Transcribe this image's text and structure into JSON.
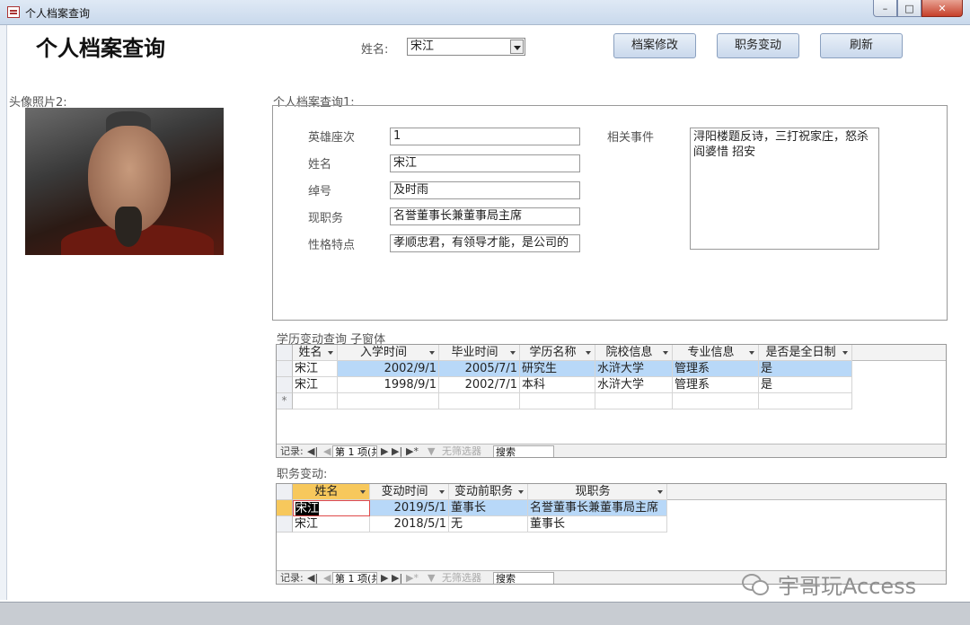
{
  "window": {
    "title": "个人档案查询"
  },
  "form": {
    "title": "个人档案查询",
    "name_label": "姓名:",
    "name_combo_value": "宋江",
    "buttons": {
      "edit": "档案修改",
      "job_change": "职务变动",
      "refresh": "刷新"
    },
    "photo_label": "头像照片2:",
    "group_label": "个人档案查询1:",
    "fields": [
      {
        "label": "英雄座次",
        "value": "1"
      },
      {
        "label": "姓名",
        "value": "宋江"
      },
      {
        "label": "绰号",
        "value": "及时雨"
      },
      {
        "label": "现职务",
        "value": "名誉董事长兼董事局主席"
      },
      {
        "label": "性格特点",
        "value": "孝顺忠君，有领导才能，是公司的"
      }
    ],
    "events_label": "相关事件",
    "events_value": "浔阳楼题反诗，三打祝家庄，怒杀阎婆惜 招安"
  },
  "education": {
    "caption": "学历变动查询 子窗体",
    "columns": [
      "姓名",
      "入学时间",
      "毕业时间",
      "学历名称",
      "院校信息",
      "专业信息",
      "是否是全日制"
    ],
    "rows": [
      [
        "宋江",
        "2002/9/1",
        "2005/7/1",
        "研究生",
        "水浒大学",
        "管理系",
        "是"
      ],
      [
        "宋江",
        "1998/9/1",
        "2002/7/1",
        "本科",
        "水浒大学",
        "管理系",
        "是"
      ]
    ],
    "new_row_marker": "*",
    "nav": {
      "record_label": "记录:",
      "record_no": "第 1 项(共",
      "filter": "无筛选器",
      "search": "搜索"
    }
  },
  "jobs": {
    "caption": "职务变动:",
    "columns": [
      "姓名",
      "变动时间",
      "变动前职务",
      "现职务"
    ],
    "rows": [
      [
        "宋江",
        "2019/5/1",
        "董事长",
        "名誉董事长兼董事局主席"
      ],
      [
        "宋江",
        "2018/5/1",
        "无",
        "董事长"
      ]
    ],
    "nav": {
      "record_label": "记录:",
      "record_no": "第 1 项(共",
      "filter": "无筛选器",
      "search": "搜索"
    }
  },
  "watermark": "宇哥玩Access"
}
